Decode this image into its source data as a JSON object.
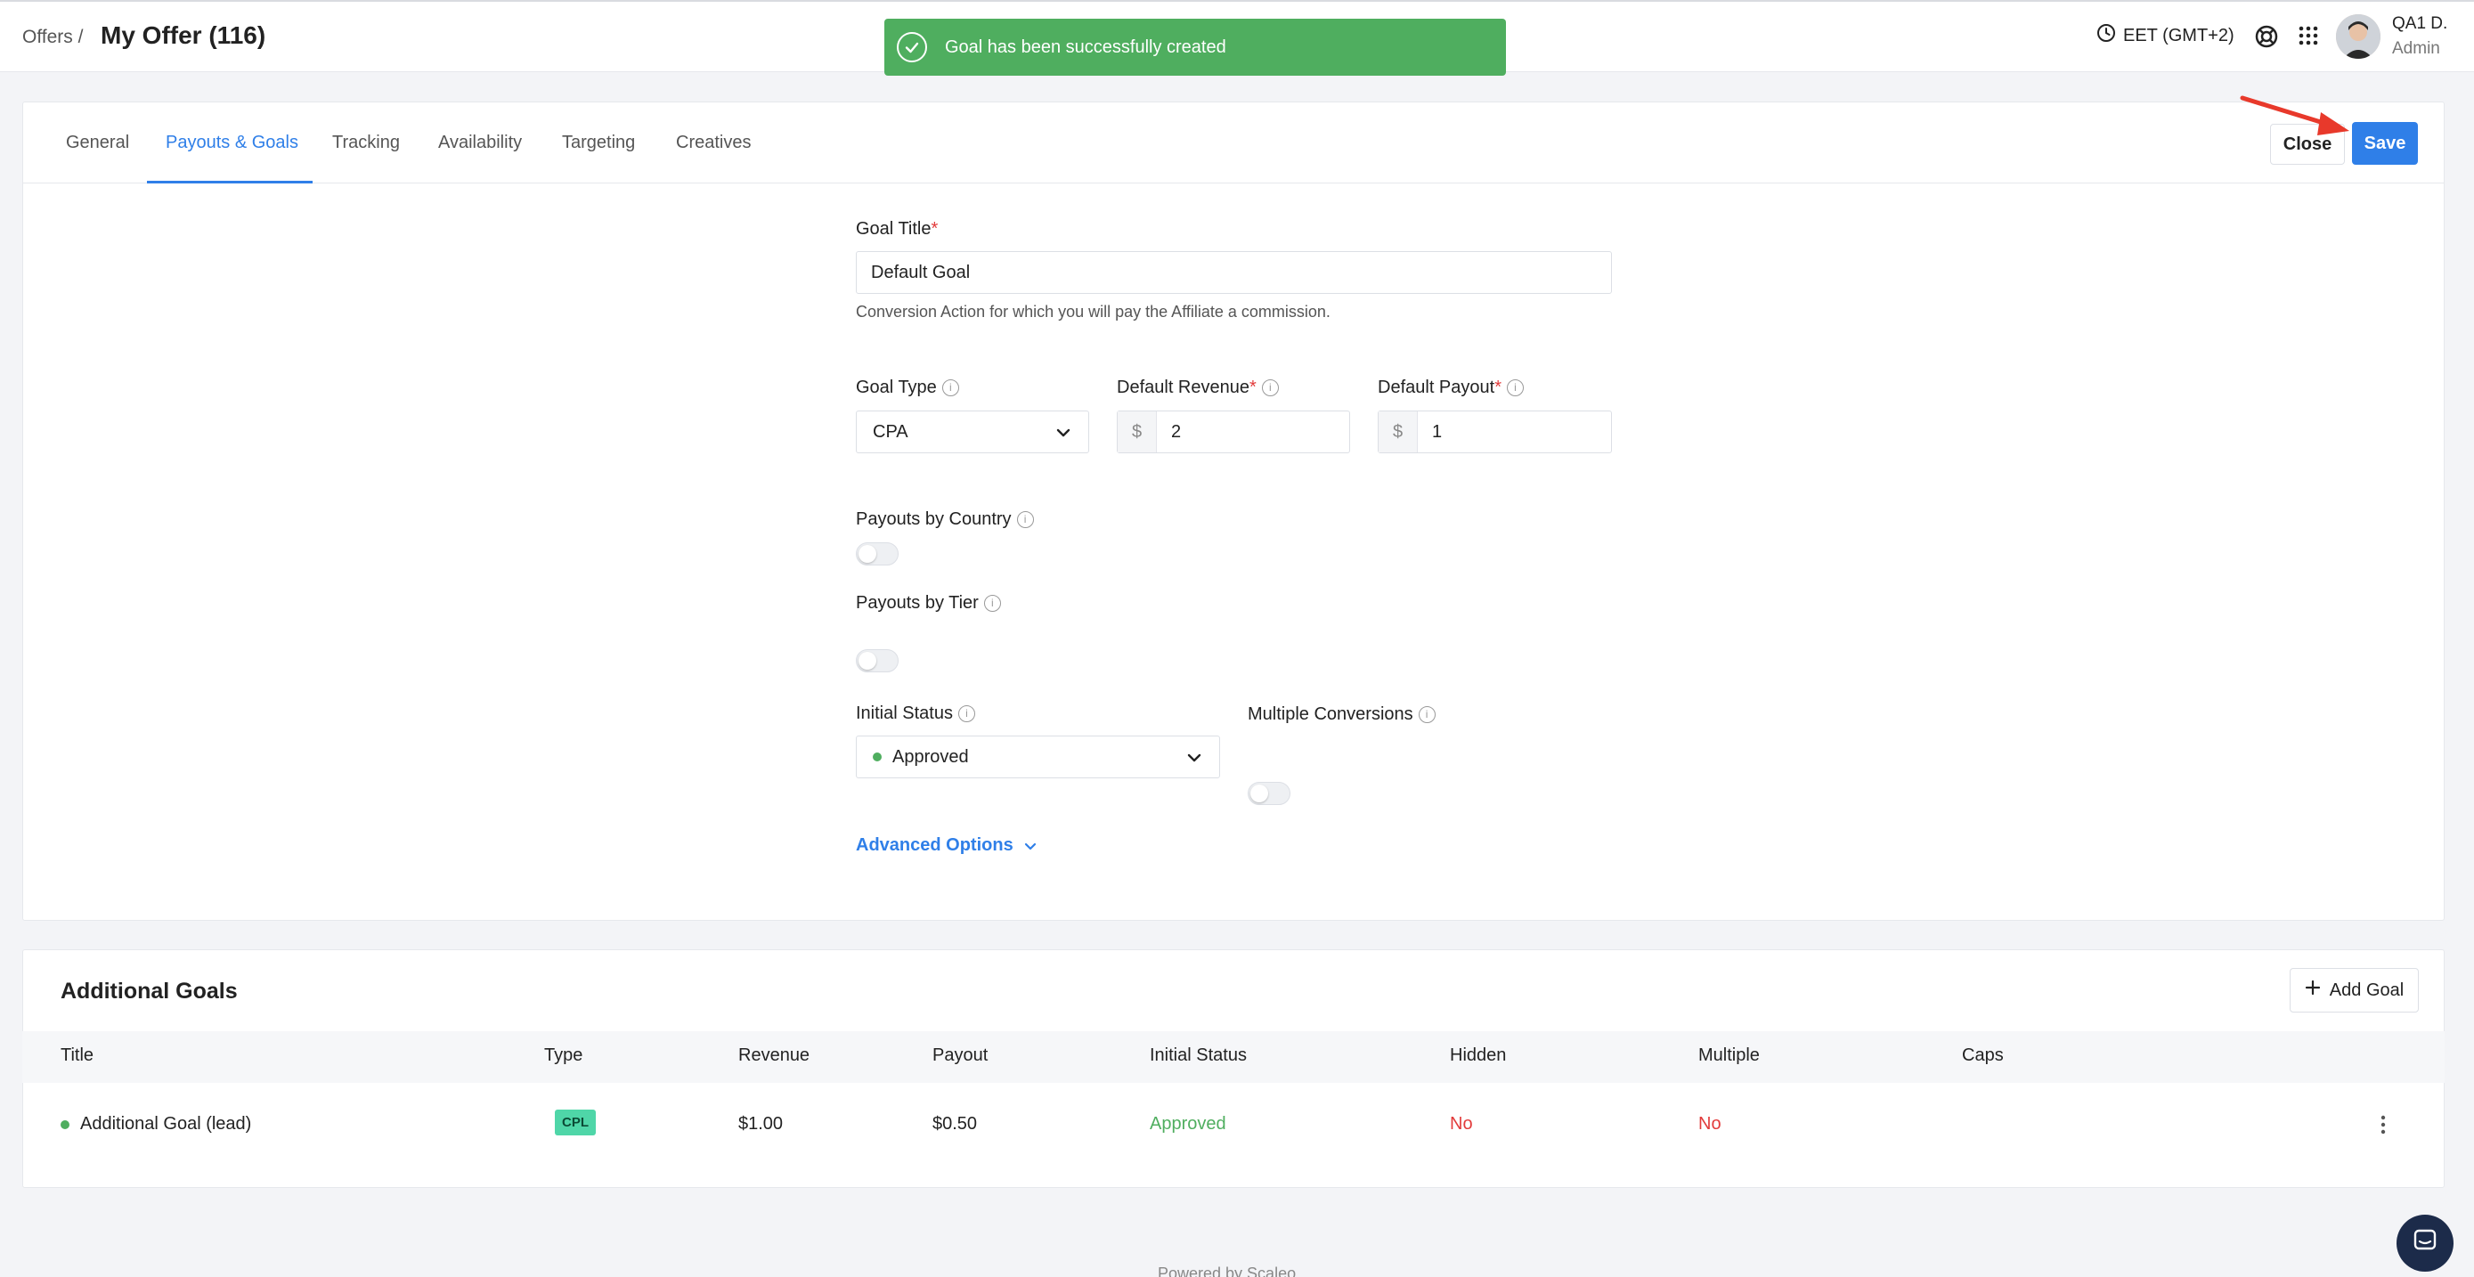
{
  "header": {
    "breadcrumb": "Offers /",
    "title": "My Offer (116)",
    "timezone": "EET (GMT+2)",
    "user_name": "QA1 D.",
    "user_role": "Admin"
  },
  "toast": {
    "message": "Goal has been successfully created",
    "color": "#4fae5f"
  },
  "tabs": [
    {
      "label": "General"
    },
    {
      "label": "Payouts & Goals"
    },
    {
      "label": "Tracking"
    },
    {
      "label": "Availability"
    },
    {
      "label": "Targeting"
    },
    {
      "label": "Creatives"
    }
  ],
  "actions": {
    "close_label": "Close",
    "save_label": "Save"
  },
  "form": {
    "goal_title_label": "Goal Title",
    "required_mark": "*",
    "goal_title_value": "Default Goal",
    "goal_title_help": "Conversion Action for which you will pay the Affiliate a commission.",
    "goal_type_label": "Goal Type",
    "goal_type_value": "CPA",
    "revenue_label": "Default Revenue",
    "revenue_currency": "$",
    "revenue_value": "2",
    "payout_label": "Default Payout",
    "payout_currency": "$",
    "payout_value": "1",
    "payouts_by_country_label": "Payouts by Country",
    "payouts_by_tier_label": "Payouts by Tier",
    "initial_status_label": "Initial Status",
    "initial_status_value": "Approved",
    "multiple_conversions_label": "Multiple Conversions",
    "advanced_options_label": "Advanced Options"
  },
  "additional_goals": {
    "title": "Additional Goals",
    "add_label": "Add Goal",
    "columns": [
      "Title",
      "Type",
      "Revenue",
      "Payout",
      "Initial Status",
      "Hidden",
      "Multiple",
      "Caps"
    ],
    "rows": [
      {
        "title": "Additional Goal (lead)",
        "type": "CPL",
        "revenue": "$1.00",
        "payout": "$0.50",
        "initial_status": "Approved",
        "hidden": "No",
        "multiple": "No",
        "caps": ""
      }
    ]
  },
  "footer": {
    "text": "Powered by Scaleo"
  },
  "colors": {
    "accent": "#2f7fe8",
    "success": "#4fae5f",
    "danger": "#e23b3b"
  }
}
